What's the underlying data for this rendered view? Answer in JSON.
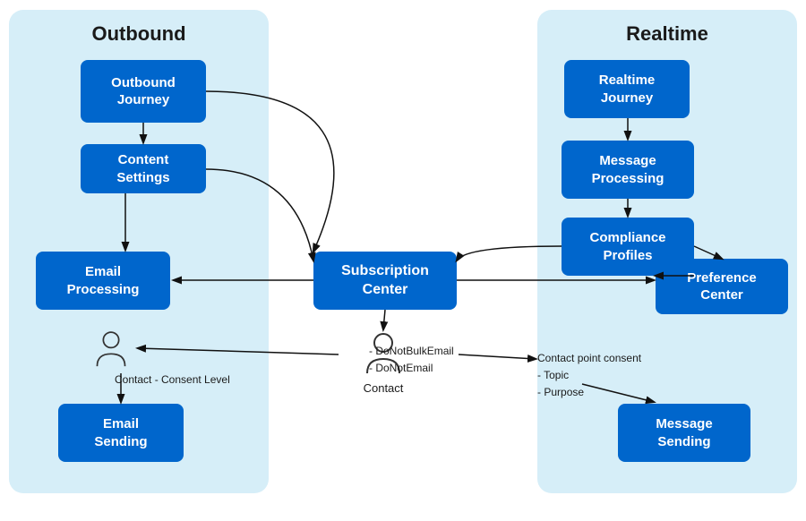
{
  "diagram": {
    "title_outbound": "Outbound",
    "title_realtime": "Realtime",
    "boxes": {
      "outbound_journey": "Outbound\nJourney",
      "content_settings": "Content\nSettings",
      "email_processing": "Email\nProcessing",
      "email_sending": "Email\nSending",
      "subscription_center": "Subscription\nCenter",
      "realtime_journey": "Realtime\nJourney",
      "message_processing": "Message\nProcessing",
      "compliance_profiles": "Compliance\nProfiles",
      "preference_center": "Preference\nCenter",
      "message_sending": "Message\nSending"
    },
    "contact_label": "Contact",
    "contact_props": [
      "DoNotBulkEmail",
      "DoNotEmail"
    ],
    "left_contact_label": "Contact -  Consent Level",
    "right_contact_props": [
      "Contact point consent",
      "Topic",
      "Purpose"
    ]
  }
}
